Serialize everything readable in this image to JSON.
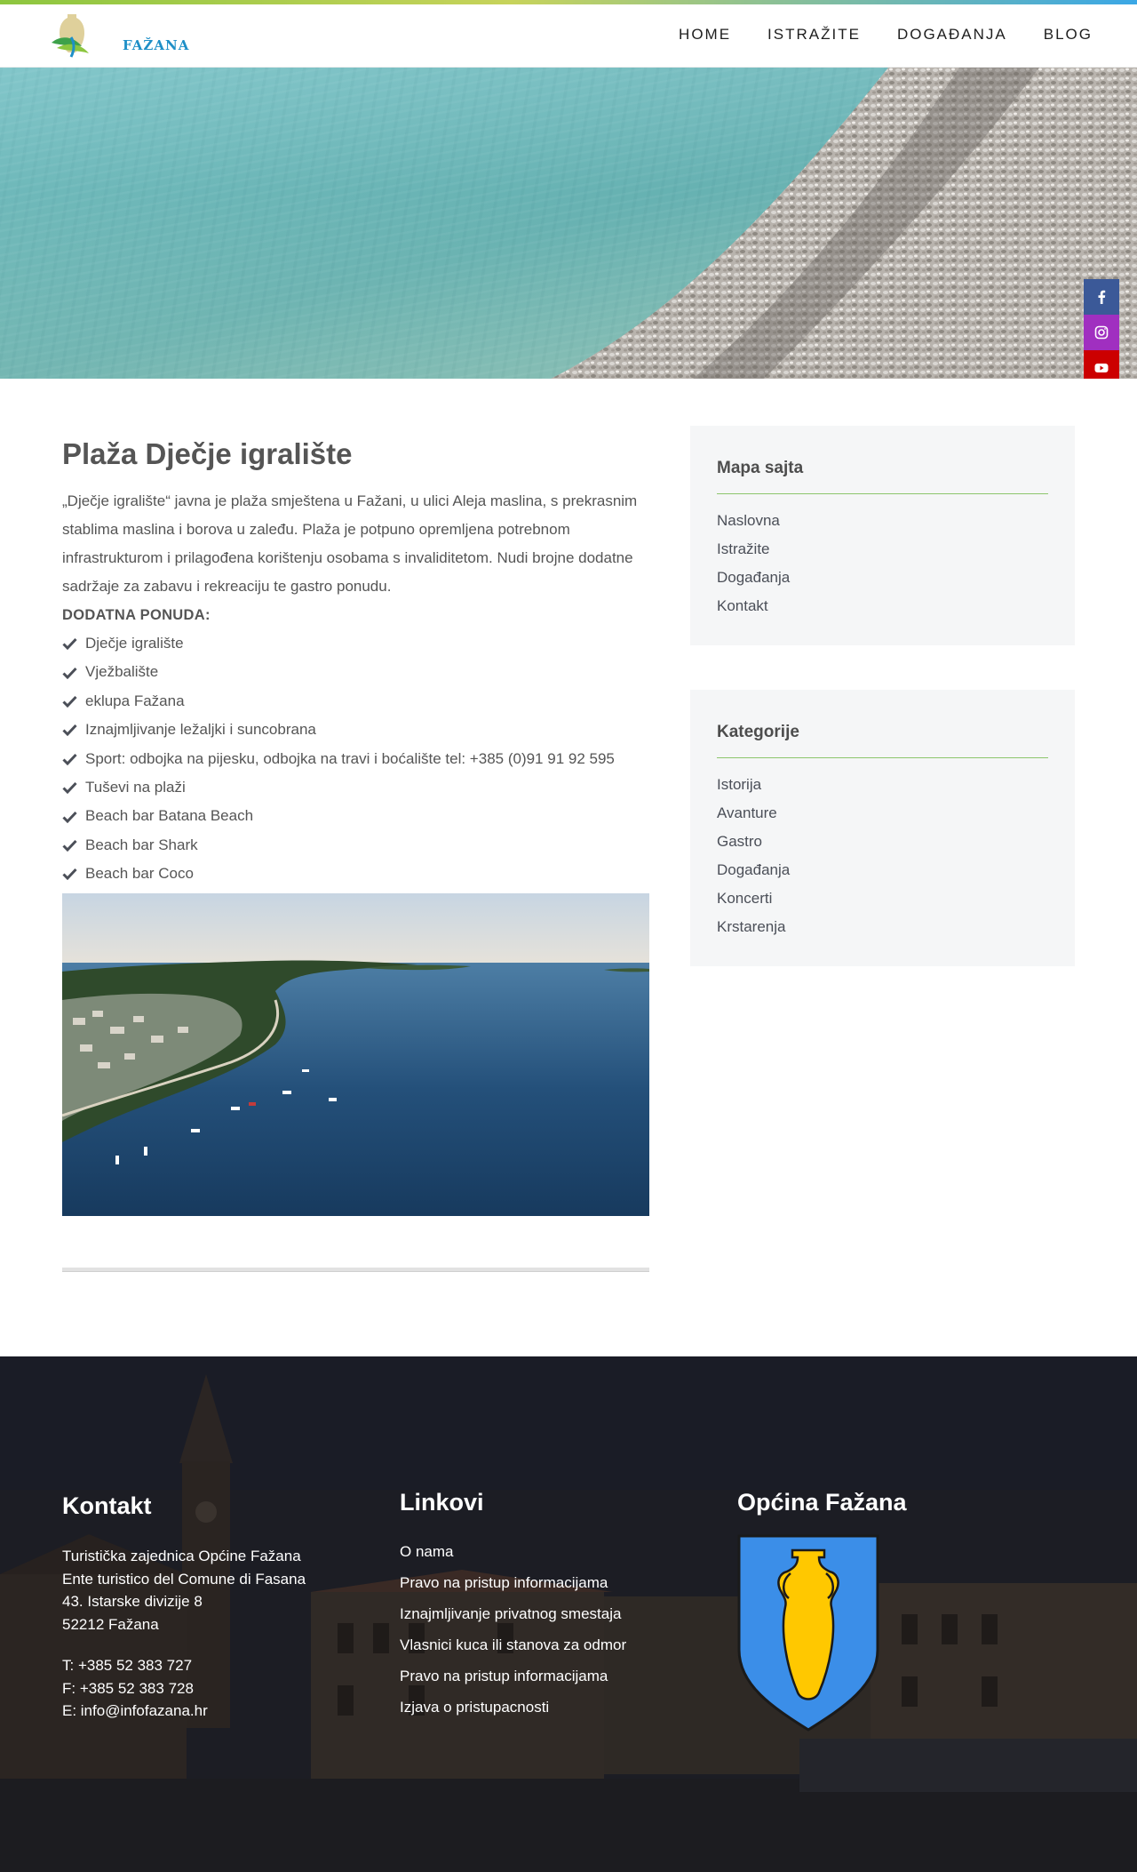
{
  "header": {
    "logo_text": "FAŽANA",
    "nav": [
      "HOME",
      "ISTRAŽITE",
      "DOGAĐANJA",
      "BLOG"
    ]
  },
  "social": [
    "facebook-icon",
    "instagram-icon",
    "youtube-icon"
  ],
  "colors": {
    "accent_green": "#8cc66d",
    "facebook": "#3b5998",
    "instagram": "#a02fc0",
    "youtube": "#cc0000",
    "footer_bg": "#1a1b22"
  },
  "article": {
    "title": "Plaža Dječje igralište",
    "intro": "„Dječje igralište“ javna je plaža smještena u Fažani, u ulici Aleja maslina, s prekrasnim stablima maslina i borova u zaleđu. Plaža je potpuno opremljena potrebnom infrastrukturom i prilagođena korištenju osobama s invaliditetom. Nudi brojne dodatne sadržaje za zabavu i rekreaciju te gastro ponudu.",
    "offer_heading": "DODATNA PONUDA:",
    "offers": [
      "Dječje igralište",
      "Vježbalište",
      "eklupa Fažana",
      "Iznajmljivanje ležaljki i suncobrana",
      "Sport: odbojka na pijesku, odbojka na travi i boćalište tel: +385 (0)91 91 92 595",
      "Tuševi na plaži",
      "Beach bar Batana Beach",
      "Beach bar Shark",
      "Beach bar Coco"
    ]
  },
  "sidebar": {
    "sitemap": {
      "title": "Mapa sajta",
      "links": [
        "Naslovna",
        "Istražite",
        "Događanja",
        "Kontakt"
      ]
    },
    "categories": {
      "title": "Kategorije",
      "links": [
        "Istorija",
        "Avanture",
        "Gastro",
        "Događanja",
        "Koncerti",
        "Krstarenja"
      ]
    }
  },
  "footer": {
    "contact": {
      "title": "Kontakt",
      "address": [
        "Turistička zajednica Općine Fažana",
        "Ente turistico del Comune di Fasana",
        "43. Istarske divizije 8",
        "52212 Fažana"
      ],
      "phone": "T: +385 52 383 727",
      "fax": "F: +385 52 383 728",
      "email": "E: info@infofazana.hr"
    },
    "links": {
      "title": "Linkovi",
      "items": [
        "O nama",
        "Pravo na pristup informacijama",
        "Iznajmljivanje privatnog smestaja",
        "Vlasnici kuca ili stanova za odmor",
        "Pravo na pristup informacijama",
        "Izjava o pristupacnosti"
      ]
    },
    "municipality": {
      "title": "Općina Fažana"
    }
  }
}
